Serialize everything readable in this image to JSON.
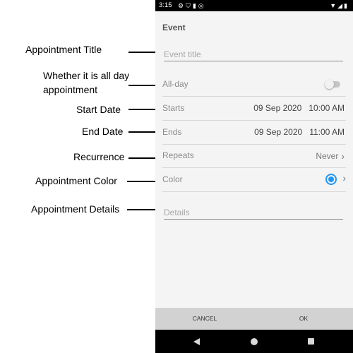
{
  "annotations": [
    {
      "text": "Appointment Title"
    },
    {
      "text": "Whether it is all day appointment"
    },
    {
      "text": "Start Date"
    },
    {
      "text": "End Date"
    },
    {
      "text": "Recurrence"
    },
    {
      "text": "Appointment Color"
    },
    {
      "text": "Appointment Details"
    }
  ],
  "status_bar": {
    "time": "3:15",
    "icons": [
      "gear-icon",
      "shield-icon",
      "sim-icon",
      "sync-icon"
    ],
    "right_icons": [
      "wifi-icon",
      "signal-icon",
      "battery-icon"
    ]
  },
  "editor": {
    "header": "Event",
    "title_placeholder": "Event title",
    "all_day": {
      "label": "All-day",
      "enabled": false
    },
    "starts": {
      "label": "Starts",
      "date": "09 Sep 2020",
      "time": "10:00 AM"
    },
    "ends": {
      "label": "Ends",
      "date": "09 Sep 2020",
      "time": "11:00 AM"
    },
    "repeats": {
      "label": "Repeats",
      "value": "Never"
    },
    "color": {
      "label": "Color",
      "value": "#2196f3"
    },
    "details_placeholder": "Details"
  },
  "footer": {
    "cancel": "CANCEL",
    "ok": "OK"
  },
  "nav_bar": {
    "icons": [
      "back-icon",
      "home-icon",
      "recents-icon"
    ]
  }
}
